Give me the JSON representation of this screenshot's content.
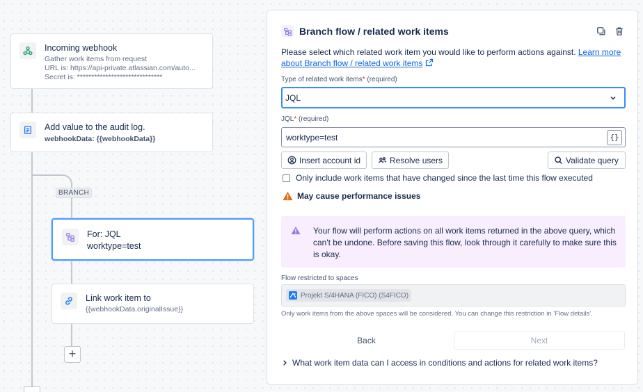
{
  "canvas": {
    "nodes": [
      {
        "title": "Incoming webhook",
        "lines": [
          "Gather work items from request",
          "URL is: https://api-private.atlassian.com/auto...",
          "Secret is: ******************************"
        ]
      },
      {
        "title": "Add value to the audit log.",
        "lines": [
          "webhookData: {{webhookData}}"
        ]
      },
      {
        "title": "For: JQL",
        "lines": [
          "worktype=test"
        ]
      },
      {
        "title": "Link work item to",
        "lines": [
          "{{webhookData.originalIssue}}"
        ]
      }
    ],
    "branch_label": "BRANCH",
    "add_label": "+"
  },
  "panel": {
    "title": "Branch flow / related work items",
    "intro_text": "Please select which related work item you would like to perform actions against. ",
    "intro_link": "Learn more about Branch flow / related work items",
    "type_label": "Type of related work items",
    "type_required": "(required)",
    "type_value": "JQL",
    "jql_label": "JQL",
    "jql_required": "(required)",
    "jql_value": "worktype=test",
    "jql_brace": "{}",
    "buttons": {
      "insert_account": "Insert account id",
      "resolve_users": "Resolve users",
      "validate_query": "Validate query"
    },
    "checkbox_label": "Only include work items that have changed since the last time this flow executed",
    "performance_warning": "May cause performance issues",
    "alert_text": "Your flow will perform actions on all work items returned in the above query, which can't be undone. Before saving this flow, look through it carefully to make sure this is okay.",
    "spaces_label": "Flow restricted to spaces",
    "space_chip": "Projekt S/4HANA (FICO) (S4FICO)",
    "spaces_help": "Only work items from the above spaces will be considered. You can change this restriction in 'Flow details'.",
    "back_label": "Back",
    "next_label": "Next",
    "faq_label": "What work item data can I access in conditions and actions for related work items?"
  },
  "colors": {
    "accent": "#0c66e4",
    "focus": "#388bff",
    "alert_bg": "#f8eefe",
    "warning": "#e56910",
    "discovery": "#8f7ee7"
  }
}
